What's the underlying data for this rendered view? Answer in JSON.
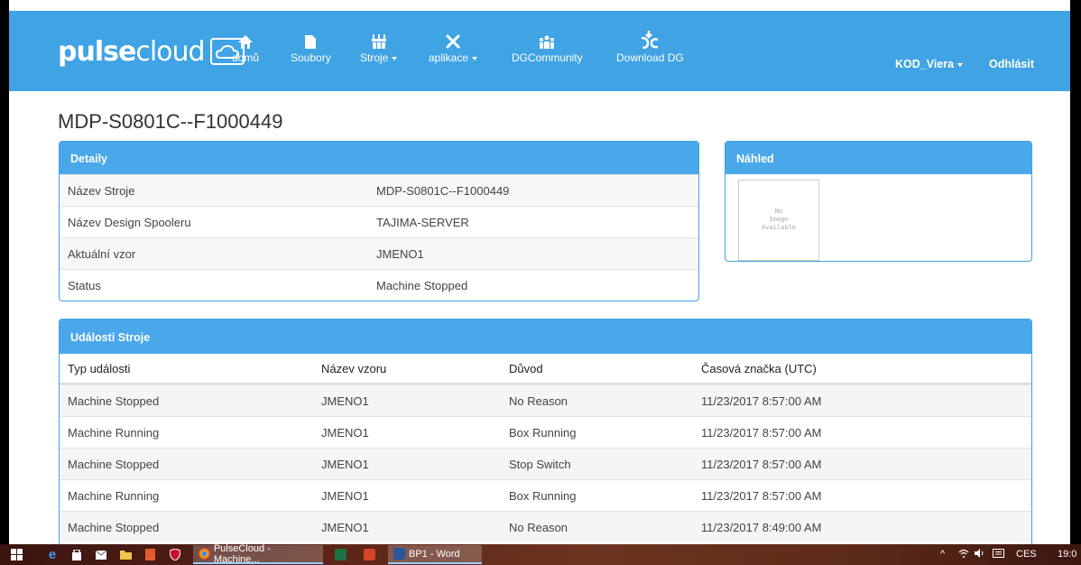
{
  "brand": {
    "name_bold": "pulse",
    "name_light": "cloud"
  },
  "nav": {
    "home": "domů",
    "files": "Soubory",
    "machines": "Stroje",
    "apps": "aplikace",
    "community": "DGCommunity",
    "download": "Download DG",
    "user": "KOD_Viera",
    "logout": "Odhlásit"
  },
  "page": {
    "title": "MDP-S0801C--F1000449"
  },
  "details": {
    "heading": "Detaily",
    "rows": [
      {
        "label": "Název Stroje",
        "value": "MDP-S0801C--F1000449"
      },
      {
        "label": "Název Design Spooleru",
        "value": "TAJIMA-SERVER"
      },
      {
        "label": "Aktuální vzor",
        "value": "JMENO1"
      },
      {
        "label": "Status",
        "value": "Machine Stopped"
      }
    ]
  },
  "preview": {
    "heading": "Náhled",
    "placeholder_line1": "No",
    "placeholder_line2": "Image",
    "placeholder_line3": "Available"
  },
  "events": {
    "heading": "Události Stroje",
    "columns": [
      "Typ události",
      "Název vzoru",
      "Důvod",
      "Časová značka (UTC)"
    ],
    "rows": [
      [
        "Machine Stopped",
        "JMENO1",
        "No Reason",
        "11/23/2017 8:57:00 AM"
      ],
      [
        "Machine Running",
        "JMENO1",
        "Box Running",
        "11/23/2017 8:57:00 AM"
      ],
      [
        "Machine Stopped",
        "JMENO1",
        "Stop Switch",
        "11/23/2017 8:57:00 AM"
      ],
      [
        "Machine Running",
        "JMENO1",
        "Box Running",
        "11/23/2017 8:57:00 AM"
      ],
      [
        "Machine Stopped",
        "JMENO1",
        "No Reason",
        "11/23/2017 8:49:00 AM"
      ]
    ]
  },
  "taskbar": {
    "task_chrome": "PulseCloud - Machine...",
    "task_word": "BP1 - Word",
    "lang": "CES",
    "time": "19:0"
  },
  "colors": {
    "primary": "#3fa3e4",
    "panel_head": "#4aa7ea"
  }
}
